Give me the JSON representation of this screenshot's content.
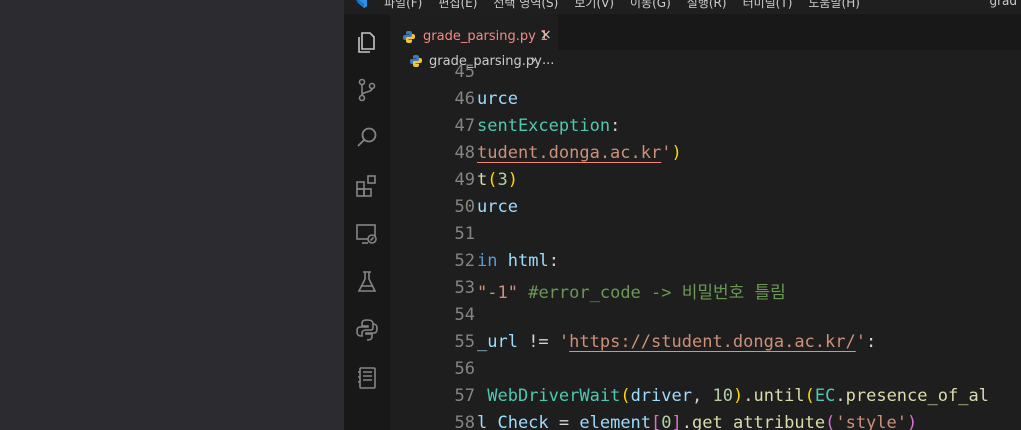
{
  "menubar": {
    "items": [
      "파일(F)",
      "편집(E)",
      "선택 영역(S)",
      "보기(V)",
      "이동(G)",
      "실행(R)",
      "터미널(T)",
      "도움말(H)"
    ],
    "title": "grad"
  },
  "activity_bar": {
    "icons": [
      "explorer-icon",
      "source-control-icon",
      "search-icon",
      "extensions-icon",
      "remote-explorer-icon",
      "testing-icon",
      "python-icon",
      "notebook-icon"
    ]
  },
  "tab": {
    "filename": "grade_parsing.py",
    "problem_count": "1",
    "close_glyph": "×"
  },
  "breadcrumb": {
    "filename": "grade_parsing.py",
    "separator": "›",
    "more": "..."
  },
  "colors": {
    "error_text": "#f28b82",
    "background": "#1e1e1e"
  },
  "code": {
    "lines": [
      {
        "num": "45",
        "tokens": []
      },
      {
        "num": "46",
        "tokens": [
          {
            "t": "urce",
            "c": "var"
          }
        ]
      },
      {
        "num": "47",
        "tokens": [
          {
            "t": "sentException",
            "c": "cls"
          },
          {
            "t": ":",
            "c": "op"
          }
        ]
      },
      {
        "num": "48",
        "tokens": [
          {
            "t": "tudent.donga.ac.kr",
            "c": "str",
            "err": true
          },
          {
            "t": "'",
            "c": "str"
          },
          {
            "t": ")",
            "c": "br1"
          }
        ]
      },
      {
        "num": "49",
        "tokens": [
          {
            "t": "t",
            "c": "fn"
          },
          {
            "t": "(",
            "c": "br1"
          },
          {
            "t": "3",
            "c": "num"
          },
          {
            "t": ")",
            "c": "br1"
          }
        ]
      },
      {
        "num": "50",
        "tokens": [
          {
            "t": "urce",
            "c": "var"
          }
        ]
      },
      {
        "num": "51",
        "tokens": []
      },
      {
        "num": "52",
        "tokens": [
          {
            "t": "in",
            "c": "kw"
          },
          {
            "t": " ",
            "c": "def"
          },
          {
            "t": "html",
            "c": "var"
          },
          {
            "t": ":",
            "c": "op"
          }
        ]
      },
      {
        "num": "53",
        "tokens": [
          {
            "t": "\"-1\"",
            "c": "str"
          },
          {
            "t": " ",
            "c": "def"
          },
          {
            "t": "#error_code -> 비밀번호 틀림",
            "c": "cmt"
          }
        ]
      },
      {
        "num": "54",
        "tokens": []
      },
      {
        "num": "55",
        "tokens": [
          {
            "t": "_url",
            "c": "var"
          },
          {
            "t": " != ",
            "c": "op"
          },
          {
            "t": "'",
            "c": "str"
          },
          {
            "t": "https://student.donga.ac.kr/",
            "c": "str",
            "err": true
          },
          {
            "t": "'",
            "c": "str"
          },
          {
            "t": ":",
            "c": "op"
          }
        ]
      },
      {
        "num": "56",
        "tokens": []
      },
      {
        "num": "57",
        "tokens": [
          {
            "t": " ",
            "c": "def"
          },
          {
            "t": "WebDriverWait",
            "c": "cls"
          },
          {
            "t": "(",
            "c": "br1"
          },
          {
            "t": "driver",
            "c": "var"
          },
          {
            "t": ", ",
            "c": "op"
          },
          {
            "t": "10",
            "c": "num"
          },
          {
            "t": ")",
            "c": "br1"
          },
          {
            "t": ".",
            "c": "op"
          },
          {
            "t": "until",
            "c": "fn"
          },
          {
            "t": "(",
            "c": "br1"
          },
          {
            "t": "EC",
            "c": "cls"
          },
          {
            "t": ".",
            "c": "op"
          },
          {
            "t": "presence_of_al",
            "c": "fn"
          }
        ]
      },
      {
        "num": "58",
        "tokens": [
          {
            "t": "l_Check",
            "c": "var"
          },
          {
            "t": " = ",
            "c": "op"
          },
          {
            "t": "element",
            "c": "var"
          },
          {
            "t": "[",
            "c": "br2"
          },
          {
            "t": "0",
            "c": "num"
          },
          {
            "t": "]",
            "c": "br2"
          },
          {
            "t": ".",
            "c": "op"
          },
          {
            "t": "get_attribute",
            "c": "fn"
          },
          {
            "t": "(",
            "c": "br2"
          },
          {
            "t": "'style'",
            "c": "str"
          },
          {
            "t": ")",
            "c": "br2"
          }
        ]
      }
    ]
  }
}
